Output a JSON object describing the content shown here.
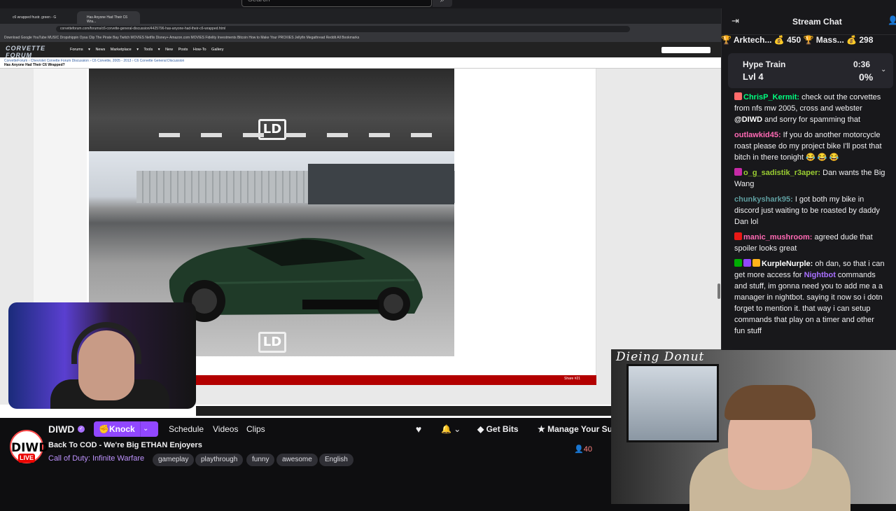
{
  "top": {
    "search_placeholder": "Search"
  },
  "browser": {
    "tabs": [
      "c6 wrapped frustr. green - G",
      "Has Anyone Had Their C6 Wra..."
    ],
    "url": "corvetteforum.com/forums/c6-corvette-general-discussion/4425796-has-anyone-had-their-c6-wrapped.html",
    "bookmarks": "Download  Google  YouTube  MUSIC  Dropshippin  Oysa Clip  The Pirate Bay  Twitch  MOVIES  Netflix  Disney+  Amazon.com  MOVIES  Fidelity Investments  Bitcoin  How to Make Your  PROXIES  Jellyfin Megathread  Reddit  All Bookmarks"
  },
  "forum": {
    "logo": "CORVETTE FORUM",
    "nav": "Forums ▾  News  Marketplace ▾  Tools ▾  New Posts  How-To  Gallery",
    "breadcrumb": "CorvetteForum › Chevrolet Corvette Forum Discussion › C6 Corvette, 2005 - 2013 › C6 Corvette General Discussion",
    "thread_title": "Has Anyone Had Their C6 Wrapped?",
    "watermark": "LD",
    "share_label": "Share  #21"
  },
  "channel": {
    "name": "DIWD",
    "avatar_text": "DIWD",
    "live_label": "LIVE",
    "knock_label": "Knock",
    "nav": [
      "Schedule",
      "Videos",
      "Clips"
    ],
    "stream_title": "Back To COD - We're Big ETHAN Enjoyers",
    "game": "Call of Duty: Infinite Warfare",
    "tags": [
      "gameplay",
      "playthrough",
      "funny",
      "awesome",
      "English"
    ],
    "get_bits": "Get Bits",
    "manage_sub": "Manage Your Su",
    "viewers": "40"
  },
  "cam_overlay": {
    "title": "Dieing Donut"
  },
  "chat": {
    "title": "Stream Chat",
    "leaderboard": "🏆 Arktech... 💰 450  🏆 Mass... 💰 298",
    "hype": {
      "label": "Hype Train",
      "level": "Lvl 4",
      "time": "0:36",
      "percent": "0%"
    },
    "messages": [
      {
        "user": "ChrisP_Kermit",
        "color": "#00ff7f",
        "text": " check out the corvettes from nfs mw 2005, cross and webster ",
        "mention": "@DIWD",
        "text2": " and sorry for spamming that",
        "badges": [
          "#ff6b6b"
        ]
      },
      {
        "user": "outlawkid45",
        "color": "#ff69b4",
        "text": " If you do another motorcycle roast please do my project bike I'll post that bitch in there tonight 😂 😂 😂",
        "mention": "",
        "text2": "",
        "badges": []
      },
      {
        "user": "o_g_sadistik_r3aper",
        "color": "#9acd32",
        "text": " Dan wants the Big Wang",
        "mention": "",
        "text2": "",
        "badges": [
          "#c62aa6"
        ]
      },
      {
        "user": "chunkyshark95",
        "color": "#5f9ea0",
        "text": " I got both my bike in discord just waiting to be roasted by daddy Dan lol",
        "mention": "",
        "text2": "",
        "badges": []
      },
      {
        "user": "manic_mushroom",
        "color": "#ff69b4",
        "text": " agreed dude that spoiler looks great",
        "mention": "",
        "text2": "",
        "badges": [
          "#e91916"
        ]
      },
      {
        "user": "KurpleNurple",
        "color": "#ffffff",
        "text": " oh dan, so that i can get more access for ",
        "mention": "Nightbot",
        "text2": " commands and stuff, im gonna need you to add me a a manager in nightbot. saying it now so i dotn forget to mention it. that way i can setup commands that play on a timer and other fun stuff",
        "badges": [
          "#00ad03",
          "#9147ff",
          "#ffb31a"
        ]
      }
    ]
  }
}
